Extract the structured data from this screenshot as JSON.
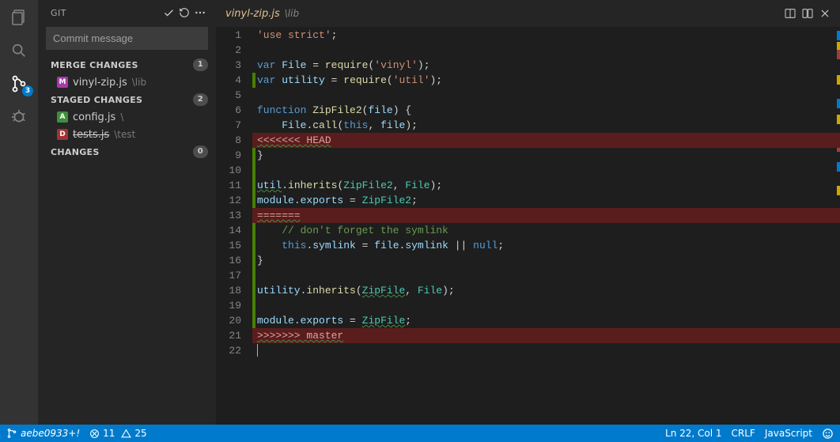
{
  "activitybar": {
    "scm_badge": "3"
  },
  "sidepanel": {
    "title": "GIT",
    "commit_placeholder": "Commit message",
    "sections": {
      "merge": {
        "label": "MERGE CHANGES",
        "count": "1"
      },
      "staged": {
        "label": "STAGED CHANGES",
        "count": "2"
      },
      "changes": {
        "label": "CHANGES",
        "count": "0"
      }
    },
    "merge_files": [
      {
        "letter": "M",
        "name": "vinyl-zip.js",
        "path": "\\lib"
      }
    ],
    "staged_files": [
      {
        "letter": "A",
        "name": "config.js",
        "path": "\\"
      },
      {
        "letter": "D",
        "name": "tests.js",
        "path": "\\test"
      }
    ]
  },
  "tabs": {
    "filename": "vinyl-zip.js",
    "filepath": "\\lib"
  },
  "code": {
    "lines": [
      {
        "n": "1",
        "m": "none",
        "hl": "",
        "html": "<span class='tok-str'>'use strict'</span><span class='tok-punc'>;</span>"
      },
      {
        "n": "2",
        "m": "none",
        "hl": "",
        "html": ""
      },
      {
        "n": "3",
        "m": "none",
        "hl": "",
        "html": "<span class='tok-kw'>var</span> <span class='tok-id'>File</span> <span class='tok-punc'>=</span> <span class='tok-fn'>require</span><span class='tok-punc'>(</span><span class='tok-str'>'vinyl'</span><span class='tok-punc'>);</span>"
      },
      {
        "n": "4",
        "m": "green",
        "hl": "",
        "html": "<span class='tok-kw'>var</span> <span class='tok-id'>utility</span> <span class='tok-punc'>=</span> <span class='tok-fn'>require</span><span class='tok-punc'>(</span><span class='tok-str'>'util'</span><span class='tok-punc'>);</span>"
      },
      {
        "n": "5",
        "m": "none",
        "hl": "",
        "html": ""
      },
      {
        "n": "6",
        "m": "none",
        "hl": "",
        "html": "<span class='tok-kw'>function</span> <span class='tok-fn'>ZipFile2</span><span class='tok-punc'>(</span><span class='tok-id'>file</span><span class='tok-punc'>) {</span>"
      },
      {
        "n": "7",
        "m": "none",
        "hl": "",
        "html": "    <span class='tok-id'>File</span><span class='tok-punc'>.</span><span class='tok-fn'>call</span><span class='tok-punc'>(</span><span class='tok-this'>this</span><span class='tok-punc'>, </span><span class='tok-id'>file</span><span class='tok-punc'>);</span>"
      },
      {
        "n": "8",
        "m": "green",
        "hl": "conflict",
        "html": "<span class='squiggle'>&lt;&lt;&lt;&lt;&lt;&lt;&lt; HEAD</span>"
      },
      {
        "n": "9",
        "m": "green",
        "hl": "",
        "html": "<span class='tok-punc'>}</span>"
      },
      {
        "n": "10",
        "m": "green",
        "hl": "",
        "html": ""
      },
      {
        "n": "11",
        "m": "green",
        "hl": "",
        "html": "<span class='tok-id squiggle'>util</span><span class='tok-punc'>.</span><span class='tok-fn'>inherits</span><span class='tok-punc'>(</span><span class='tok-type'>ZipFile2</span><span class='tok-punc'>, </span><span class='tok-type'>File</span><span class='tok-punc'>);</span>"
      },
      {
        "n": "12",
        "m": "green",
        "hl": "",
        "html": "<span class='tok-id'>module</span><span class='tok-punc'>.</span><span class='tok-id'>exports</span> <span class='tok-punc'>=</span> <span class='tok-type'>ZipFile2</span><span class='tok-punc'>;</span>"
      },
      {
        "n": "13",
        "m": "green",
        "hl": "conflict",
        "html": "<span class='squiggle'>=======</span>"
      },
      {
        "n": "14",
        "m": "green",
        "hl": "",
        "html": "    <span class='tok-comment'>// don't forget the symlink</span>"
      },
      {
        "n": "15",
        "m": "green",
        "hl": "",
        "html": "    <span class='tok-this'>this</span><span class='tok-punc'>.</span><span class='tok-id'>symlink</span> <span class='tok-punc'>=</span> <span class='tok-id'>file</span><span class='tok-punc'>.</span><span class='tok-id'>symlink</span> <span class='tok-punc'>||</span> <span class='tok-const'>null</span><span class='tok-punc'>;</span>"
      },
      {
        "n": "16",
        "m": "green",
        "hl": "",
        "html": "<span class='tok-punc'>}</span>"
      },
      {
        "n": "17",
        "m": "green",
        "hl": "",
        "html": ""
      },
      {
        "n": "18",
        "m": "green",
        "hl": "",
        "html": "<span class='tok-id'>utility</span><span class='tok-punc'>.</span><span class='tok-fn'>inherits</span><span class='tok-punc'>(</span><span class='tok-type squiggle'>ZipFile</span><span class='tok-punc'>, </span><span class='tok-type'>File</span><span class='tok-punc'>);</span>"
      },
      {
        "n": "19",
        "m": "green",
        "hl": "",
        "html": ""
      },
      {
        "n": "20",
        "m": "green",
        "hl": "",
        "html": "<span class='tok-id'>module</span><span class='tok-punc'>.</span><span class='tok-id'>exports</span> <span class='tok-punc'>=</span> <span class='tok-type squiggle'>ZipFile</span><span class='tok-punc'>;</span>"
      },
      {
        "n": "21",
        "m": "green",
        "hl": "conflict",
        "html": "<span class='squiggle'>&gt;&gt;&gt;&gt;&gt;&gt;&gt; master</span>"
      },
      {
        "n": "22",
        "m": "none",
        "hl": "",
        "html": "<span class='cursor-mark'></span>"
      }
    ]
  },
  "statusbar": {
    "branch": "aebe0933+!",
    "errors": "11",
    "warnings": "25",
    "position": "Ln 22, Col 1",
    "eol": "CRLF",
    "language": "JavaScript"
  }
}
